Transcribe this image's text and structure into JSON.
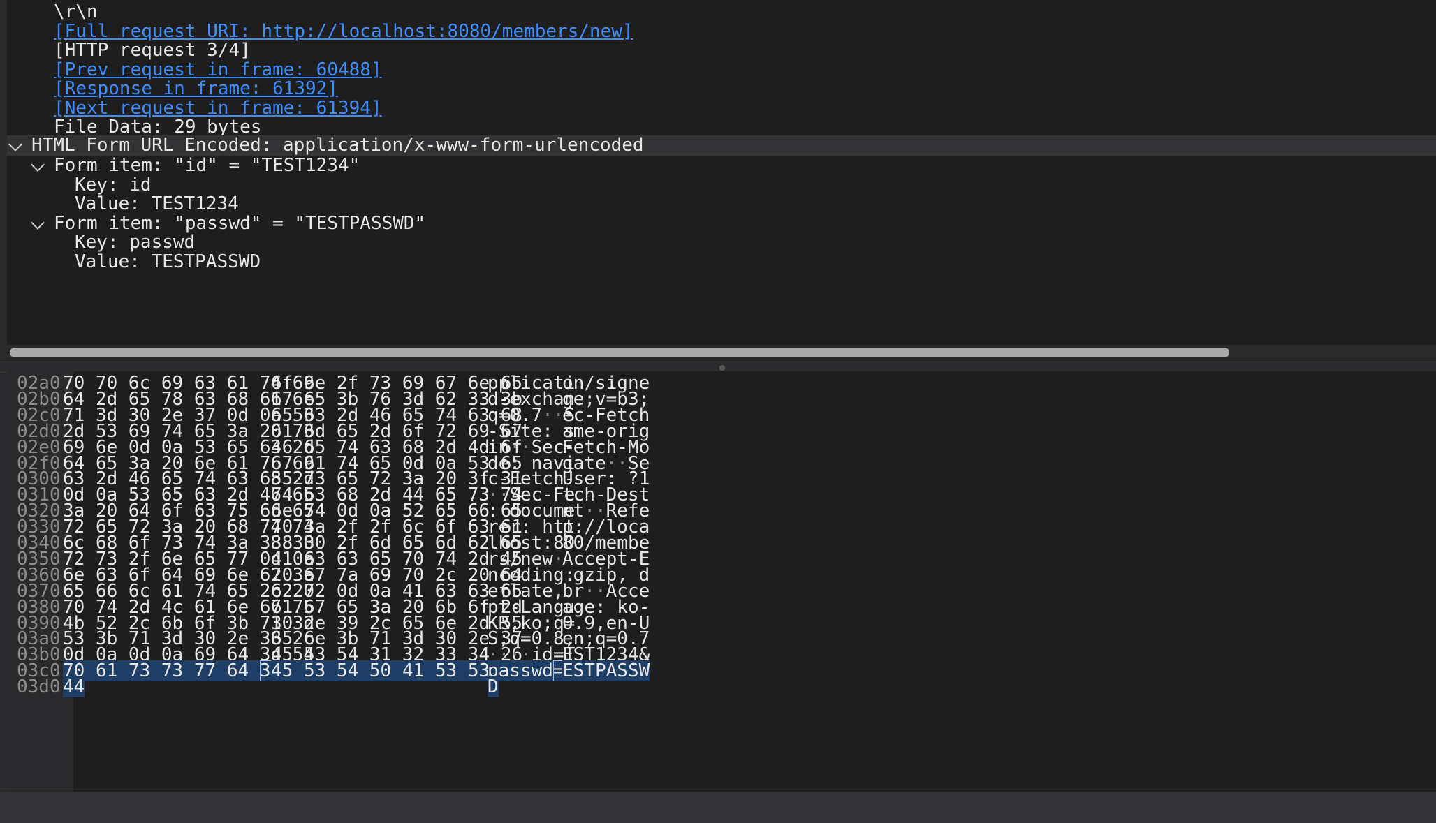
{
  "tree": {
    "rows": [
      {
        "text": "\\r\\n",
        "indent": 1,
        "link": false
      },
      {
        "text": "[Full request URI: http://localhost:8080/members/new]",
        "indent": 1,
        "link": true
      },
      {
        "text": "[HTTP request 3/4]",
        "indent": 1,
        "link": false
      },
      {
        "text": "[Prev request in frame: 60488]",
        "indent": 1,
        "link": true
      },
      {
        "text": "[Response in frame: 61392]",
        "indent": 1,
        "link": true
      },
      {
        "text": "[Next request in frame: 61394]",
        "indent": 1,
        "link": true
      },
      {
        "text": "File Data: 29 bytes",
        "indent": 1,
        "link": false
      },
      {
        "text": "HTML Form URL Encoded: application/x-www-form-urlencoded",
        "indent": 0,
        "link": false,
        "expander": true,
        "selected": true
      },
      {
        "text": "Form item: \"id\" = \"TEST1234\"",
        "indent": 1,
        "link": false,
        "expander": true
      },
      {
        "text": "Key: id",
        "indent": 2,
        "link": false
      },
      {
        "text": "Value: TEST1234",
        "indent": 2,
        "link": false
      },
      {
        "text": "Form item: \"passwd\" = \"TESTPASSWD\"",
        "indent": 1,
        "link": false,
        "expander": true
      },
      {
        "text": "Key: passwd",
        "indent": 2,
        "link": false
      },
      {
        "text": "Value: TESTPASSWD",
        "indent": 2,
        "link": false
      }
    ]
  },
  "hex": {
    "rows": [
      {
        "offset": "02a0",
        "a": "70 70 6c 69 63 61 74 69",
        "b": "6f 6e 2f 73 69 67 6e 65",
        "asc_a": "pplicati",
        "asc_b": "on/signe"
      },
      {
        "offset": "02b0",
        "a": "64 2d 65 78 63 68 61 6e",
        "b": "67 65 3b 76 3d 62 33 3b",
        "asc_a": "d-exchan",
        "asc_b": "ge;v=b3;"
      },
      {
        "offset": "02c0",
        "a": "71 3d 30 2e 37 0d 0a 53",
        "b": "65 63 2d 46 65 74 63 68",
        "asc_a": "q=0.7··S",
        "asc_b": "ec-Fetch"
      },
      {
        "offset": "02d0",
        "a": "2d 53 69 74 65 3a 20 73",
        "b": "61 6d 65 2d 6f 72 69 67",
        "asc_a": "-Site: s",
        "asc_b": "ame-orig"
      },
      {
        "offset": "02e0",
        "a": "69 6e 0d 0a 53 65 63 2d",
        "b": "46 65 74 63 68 2d 4d 6f",
        "asc_a": "in··Sec-",
        "asc_b": "Fetch-Mo"
      },
      {
        "offset": "02f0",
        "a": "64 65 3a 20 6e 61 76 69",
        "b": "67 61 74 65 0d 0a 53 65",
        "asc_a": "de: navi",
        "asc_b": "gate··Se"
      },
      {
        "offset": "0300",
        "a": "63 2d 46 65 74 63 68 2d",
        "b": "55 73 65 72 3a 20 3f 31",
        "asc_a": "c-Fetch-",
        "asc_b": "User: ?1"
      },
      {
        "offset": "0310",
        "a": "0d 0a 53 65 63 2d 46 65",
        "b": "74 63 68 2d 44 65 73 74",
        "asc_a": "··Sec-Fe",
        "asc_b": "tch-Dest"
      },
      {
        "offset": "0320",
        "a": "3a 20 64 6f 63 75 6d 65",
        "b": "6e 74 0d 0a 52 65 66 65",
        "asc_a": ": docume",
        "asc_b": "nt··Refe"
      },
      {
        "offset": "0330",
        "a": "72 65 72 3a 20 68 74 74",
        "b": "70 3a 2f 2f 6c 6f 63 61",
        "asc_a": "rer: htt",
        "asc_b": "p://loca"
      },
      {
        "offset": "0340",
        "a": "6c 68 6f 73 74 3a 38 30",
        "b": "38 30 2f 6d 65 6d 62 65",
        "asc_a": "lhost:80",
        "asc_b": "80/membe"
      },
      {
        "offset": "0350",
        "a": "72 73 2f 6e 65 77 0d 0a",
        "b": "41 63 63 65 70 74 2d 45",
        "asc_a": "rs/new··",
        "asc_b": "Accept-E"
      },
      {
        "offset": "0360",
        "a": "6e 63 6f 64 69 6e 67 3a",
        "b": "20 67 7a 69 70 2c 20 64",
        "asc_a": "ncoding:",
        "asc_b": " gzip, d"
      },
      {
        "offset": "0370",
        "a": "65 66 6c 61 74 65 2c 20",
        "b": "62 72 0d 0a 41 63 63 65",
        "asc_a": "eflate, ",
        "asc_b": "br··Acce"
      },
      {
        "offset": "0380",
        "a": "70 74 2d 4c 61 6e 67 75",
        "b": "61 67 65 3a 20 6b 6f 2d",
        "asc_a": "pt-Langu",
        "asc_b": "age: ko-"
      },
      {
        "offset": "0390",
        "a": "4b 52 2c 6b 6f 3b 71 3d",
        "b": "30 2e 39 2c 65 6e 2d 55",
        "asc_a": "KR,ko;q=",
        "asc_b": "0.9,en-U"
      },
      {
        "offset": "03a0",
        "a": "53 3b 71 3d 30 2e 38 2c",
        "b": "65 6e 3b 71 3d 30 2e 37",
        "asc_a": "S;q=0.8,",
        "asc_b": "en;q=0.7"
      },
      {
        "offset": "03b0",
        "a": "0d 0a 0d 0a 69 64 3d 54",
        "b": "45 53 54 31 32 33 34 26",
        "asc_a": "····id=T",
        "asc_b": "EST1234&"
      },
      {
        "offset": "03c0",
        "a": "70 61 73 73 77 64 3d 54",
        "b": "45 53 54 50 41 53 53 57",
        "asc_a": "passwd=T",
        "asc_b": "ESTPASSW",
        "highlight": true
      },
      {
        "offset": "03d0",
        "a": "44",
        "b": "",
        "asc_a": "D",
        "asc_b": "",
        "highlight": true
      }
    ]
  },
  "colors": {
    "link": "#3d8dff",
    "selection": "#1f3e66",
    "background": "#1e1e1e"
  }
}
